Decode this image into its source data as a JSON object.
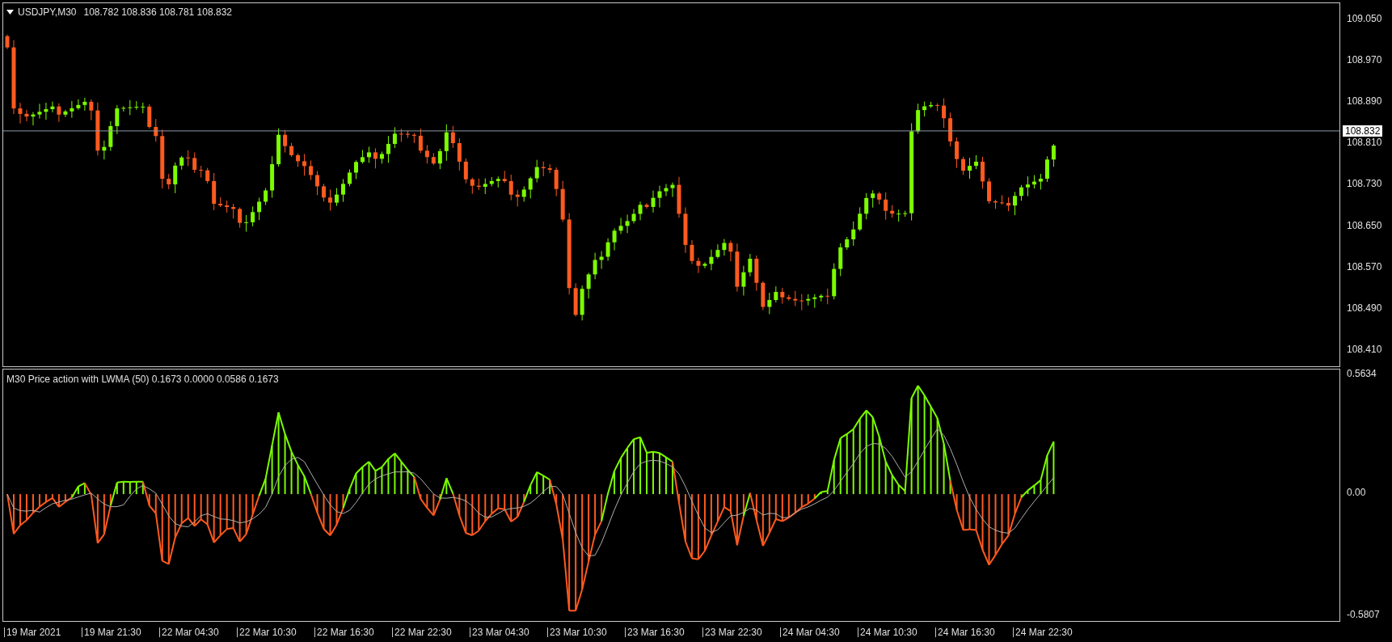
{
  "chart": {
    "title": "USDJPY,M30",
    "ohlc": "108.782 108.836 108.781 108.832",
    "price_axis": [
      "109.050",
      "108.970",
      "108.890",
      "108.810",
      "108.730",
      "108.650",
      "108.570",
      "108.490",
      "108.410"
    ],
    "current_price": "108.832"
  },
  "indicator": {
    "title": "M30 Price action with LWMA (50) 0.1673 0.0000 0.0586 0.1673",
    "axis": [
      "0.5634",
      "0.00",
      "-0.5807"
    ]
  },
  "time_axis": [
    "19 Mar 2021",
    "19 Mar 21:30",
    "22 Mar 04:30",
    "22 Mar 10:30",
    "22 Mar 16:30",
    "22 Mar 22:30",
    "23 Mar 04:30",
    "23 Mar 10:30",
    "23 Mar 16:30",
    "23 Mar 22:30",
    "24 Mar 04:30",
    "24 Mar 10:30",
    "24 Mar 16:30",
    "24 Mar 22:30"
  ]
}
